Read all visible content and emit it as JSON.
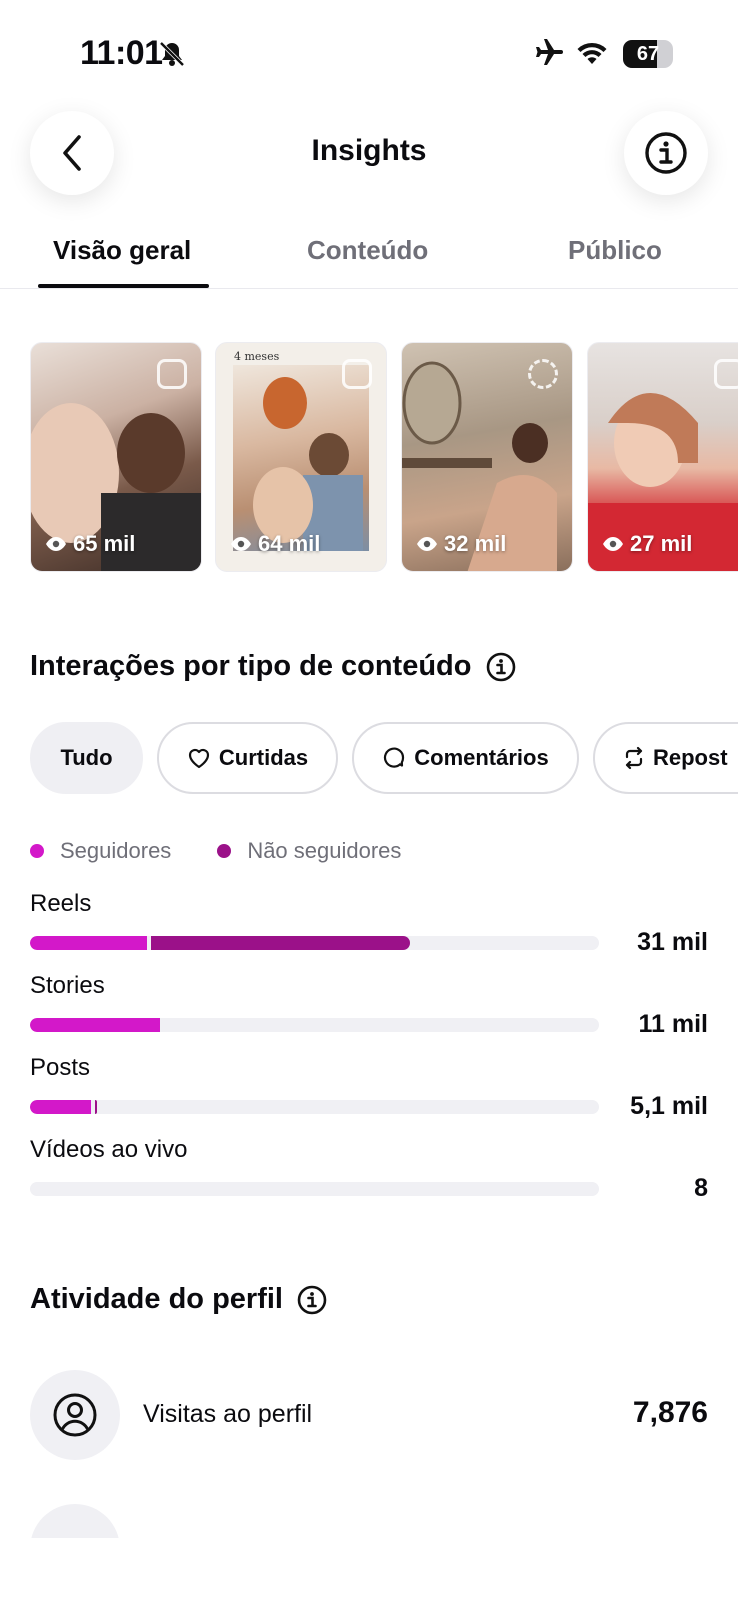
{
  "status_bar": {
    "time": "11:01",
    "battery": "67",
    "battery_level": 0.67,
    "icons": [
      "bell-slash-icon",
      "airplane-icon",
      "wifi-icon",
      "battery-icon"
    ]
  },
  "header": {
    "title": "Insights",
    "back_icon": "chevron-left-icon",
    "info_icon": "info-icon"
  },
  "tabs": [
    {
      "label": "Visão geral",
      "active": true
    },
    {
      "label": "Conteúdo",
      "active": false
    },
    {
      "label": "Público",
      "active": false
    }
  ],
  "top_content": [
    {
      "views": "65 mil",
      "type": "reel"
    },
    {
      "views": "64 mil",
      "type": "post",
      "caption": "4 meses"
    },
    {
      "views": "32 mil",
      "type": "story"
    },
    {
      "views": "27 mil",
      "type": "reel"
    }
  ],
  "interactions": {
    "title": "Interações por tipo de conteúdo",
    "filters": [
      {
        "label": "Tudo",
        "active": true,
        "icon": ""
      },
      {
        "label": "Curtidas",
        "active": false,
        "icon": "heart-icon"
      },
      {
        "label": "Comentários",
        "active": false,
        "icon": "comment-icon"
      },
      {
        "label": "Repost",
        "active": false,
        "icon": "repost-icon"
      }
    ],
    "legend": [
      {
        "label": "Seguidores",
        "color": "#d318c9"
      },
      {
        "label": "Não seguidores",
        "color": "#9b1189"
      }
    ],
    "rows": [
      {
        "label": "Reels",
        "value": "31 mil",
        "followers_fraction": 0.205,
        "nonfollowers_fraction": 0.455
      },
      {
        "label": "Stories",
        "value": "11 mil",
        "followers_fraction": 0.228,
        "nonfollowers_fraction": 0.0
      },
      {
        "label": "Posts",
        "value": "5,1 mil",
        "followers_fraction": 0.108,
        "nonfollowers_fraction": 0.004
      },
      {
        "label": "Vídeos ao vivo",
        "value": "8",
        "followers_fraction": 0.0,
        "nonfollowers_fraction": 0.0
      }
    ]
  },
  "profile_activity": {
    "title": "Atividade do perfil",
    "rows": [
      {
        "label": "Visitas ao perfil",
        "value": "7,876",
        "icon": "user-circle-icon"
      }
    ]
  },
  "colors": {
    "followers": "#d318c9",
    "non_followers": "#9b1189",
    "track": "#f0f0f4"
  }
}
